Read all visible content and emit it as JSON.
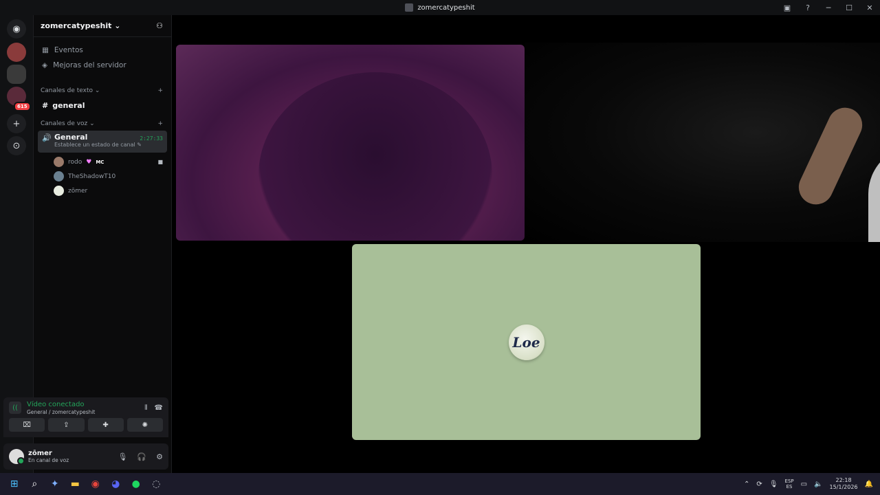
{
  "window": {
    "title": "zomercatypeshit"
  },
  "server": {
    "name": "zomercatypeshit ⌄"
  },
  "menu": {
    "events": "Eventos",
    "boosts": "Mejoras del servidor"
  },
  "text_category": {
    "label": "Canales de texto ⌄",
    "channel": "general"
  },
  "voice_category": {
    "label": "Canales de voz ⌄"
  },
  "voice_channel": {
    "name": "General",
    "status": "Establece un estado de canal ✎",
    "timer": "2:27:33"
  },
  "voice_users": [
    {
      "name": "rodo",
      "tag": "MC"
    },
    {
      "name": "TheShadowT10"
    },
    {
      "name": "zōmer"
    }
  ],
  "guild_badge": "615",
  "connection": {
    "status": "Vídeo conectado",
    "path": "General / zomercatypeshit"
  },
  "user": {
    "name": "zōmer",
    "status": "En canal de voz"
  },
  "tile3": {
    "logo_text": "Loe"
  },
  "taskbar": {
    "lang_top": "ESP",
    "lang_bottom": "ES",
    "time": "22:18",
    "date": "15/1/2026"
  }
}
